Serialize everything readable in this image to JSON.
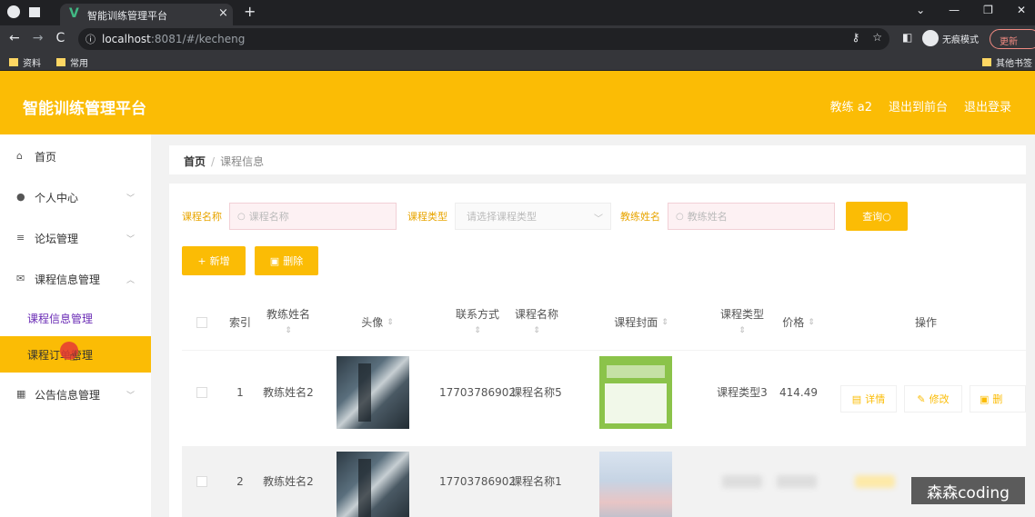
{
  "browser": {
    "tab_title": "智能训练管理平台",
    "url_host": "localhost",
    "url_rest": ":8081/#/kecheng",
    "incognito_label": "无痕模式",
    "update_label": "更新",
    "bookmarks": [
      "资料",
      "常用"
    ],
    "other_bookmarks": "其他书签"
  },
  "header": {
    "title": "智能训练管理平台",
    "user": "教练 a2",
    "to_front": "退出到前台",
    "logout": "退出登录"
  },
  "sidebar": {
    "items": [
      {
        "label": "首页",
        "icon": "home-icon"
      },
      {
        "label": "个人中心",
        "icon": "user-icon"
      },
      {
        "label": "论坛管理",
        "icon": "list-icon"
      },
      {
        "label": "课程信息管理",
        "icon": "mail-icon"
      },
      {
        "label": "公告信息管理",
        "icon": "notice-icon"
      }
    ],
    "sub_items": [
      "课程信息管理",
      "课程订单管理"
    ]
  },
  "breadcrumb": {
    "home": "首页",
    "current": "课程信息"
  },
  "search": {
    "course_name_label": "课程名称",
    "course_name_placeholder": "课程名称",
    "course_type_label": "课程类型",
    "course_type_placeholder": "请选择课程类型",
    "coach_name_label": "教练姓名",
    "coach_name_placeholder": "教练姓名",
    "query_label": "查询"
  },
  "actions": {
    "add": "新增",
    "delete": "删除"
  },
  "table": {
    "headers": {
      "index": "索引",
      "coach_name": "教练姓名",
      "avatar": "头像",
      "contact": "联系方式",
      "course_name": "课程名称",
      "cover": "课程封面",
      "course_type": "课程类型",
      "price": "价格",
      "ops": "操作"
    },
    "rows": [
      {
        "index": "1",
        "coach_name": "教练姓名2",
        "contact": "17703786902",
        "course_name": "课程名称5",
        "course_type": "课程类型3",
        "price": "414.49"
      },
      {
        "index": "2",
        "coach_name": "教练姓名2",
        "contact": "17703786902",
        "course_name": "课程名称1"
      }
    ],
    "ops": {
      "detail": "详情",
      "edit": "修改",
      "delete": "删"
    }
  },
  "watermark": "森森coding",
  "colors": {
    "accent": "#fbbc05",
    "purple": "#6a2bb5"
  }
}
